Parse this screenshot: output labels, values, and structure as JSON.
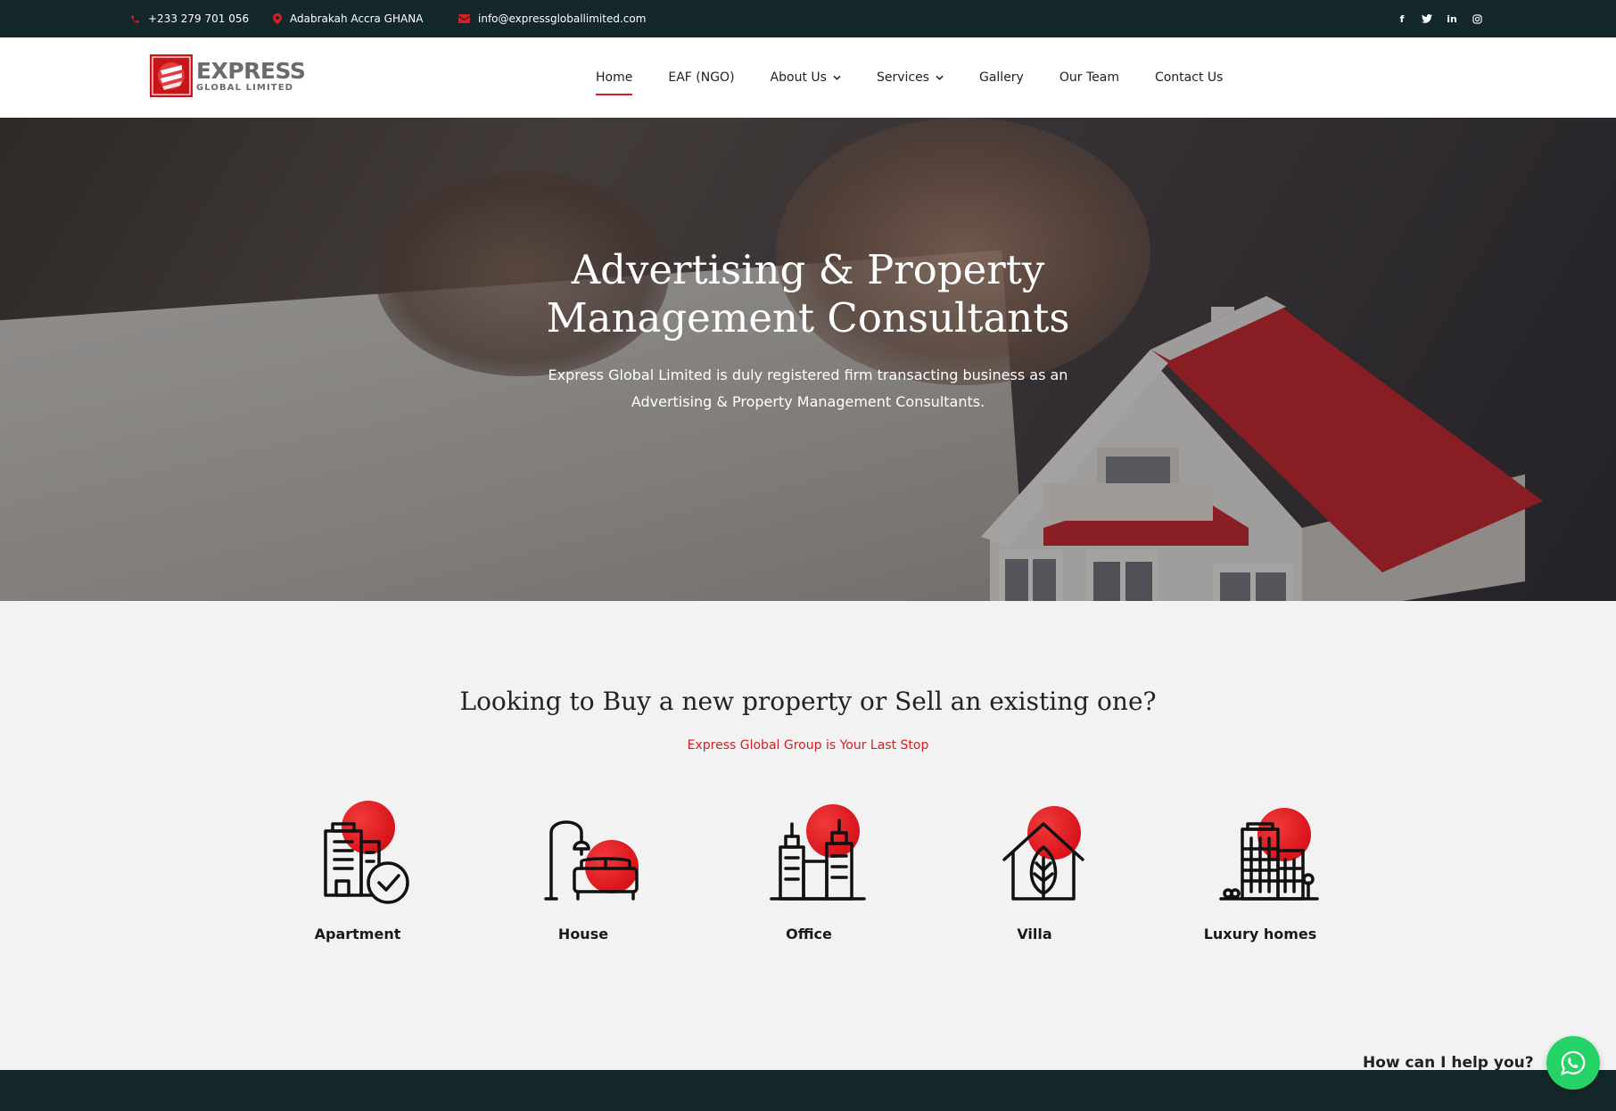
{
  "topbar": {
    "phone": "+233 279 701 056",
    "address": "Adabrakah Accra GHANA",
    "email": "info@expressgloballimited.com",
    "socials": [
      "facebook-icon",
      "twitter-icon",
      "linkedin-icon",
      "instagram-icon"
    ]
  },
  "logo": {
    "main": "EXPRESS",
    "sub": "GLOBAL LIMITED"
  },
  "nav": {
    "items": [
      {
        "label": "Home",
        "active": true
      },
      {
        "label": "EAF (NGO)"
      },
      {
        "label": "About Us",
        "dropdown": true
      },
      {
        "label": "Services",
        "dropdown": true
      },
      {
        "label": "Gallery"
      },
      {
        "label": "Our Team"
      },
      {
        "label": "Contact Us"
      }
    ]
  },
  "hero": {
    "title_line1": "Advertising & Property",
    "title_line2": "Management Consultants",
    "text": "Express Global Limited is duly registered firm transacting business as an Advertising & Property Management Consultants."
  },
  "props": {
    "title": "Looking to Buy a new property or Sell an existing one?",
    "subtitle": "Express Global Group is Your Last Stop",
    "items": [
      {
        "label": "Apartment",
        "icon": "apartment-icon"
      },
      {
        "label": "House",
        "icon": "house-icon"
      },
      {
        "label": "Office",
        "icon": "office-icon"
      },
      {
        "label": "Villa",
        "icon": "villa-icon"
      },
      {
        "label": "Luxury homes",
        "icon": "luxury-homes-icon"
      }
    ]
  },
  "chat": {
    "prompt": "How can I help you?",
    "icon": "whatsapp-icon"
  },
  "colors": {
    "accent": "#d61f26",
    "dark": "#14282b",
    "whatsapp": "#25d366"
  }
}
